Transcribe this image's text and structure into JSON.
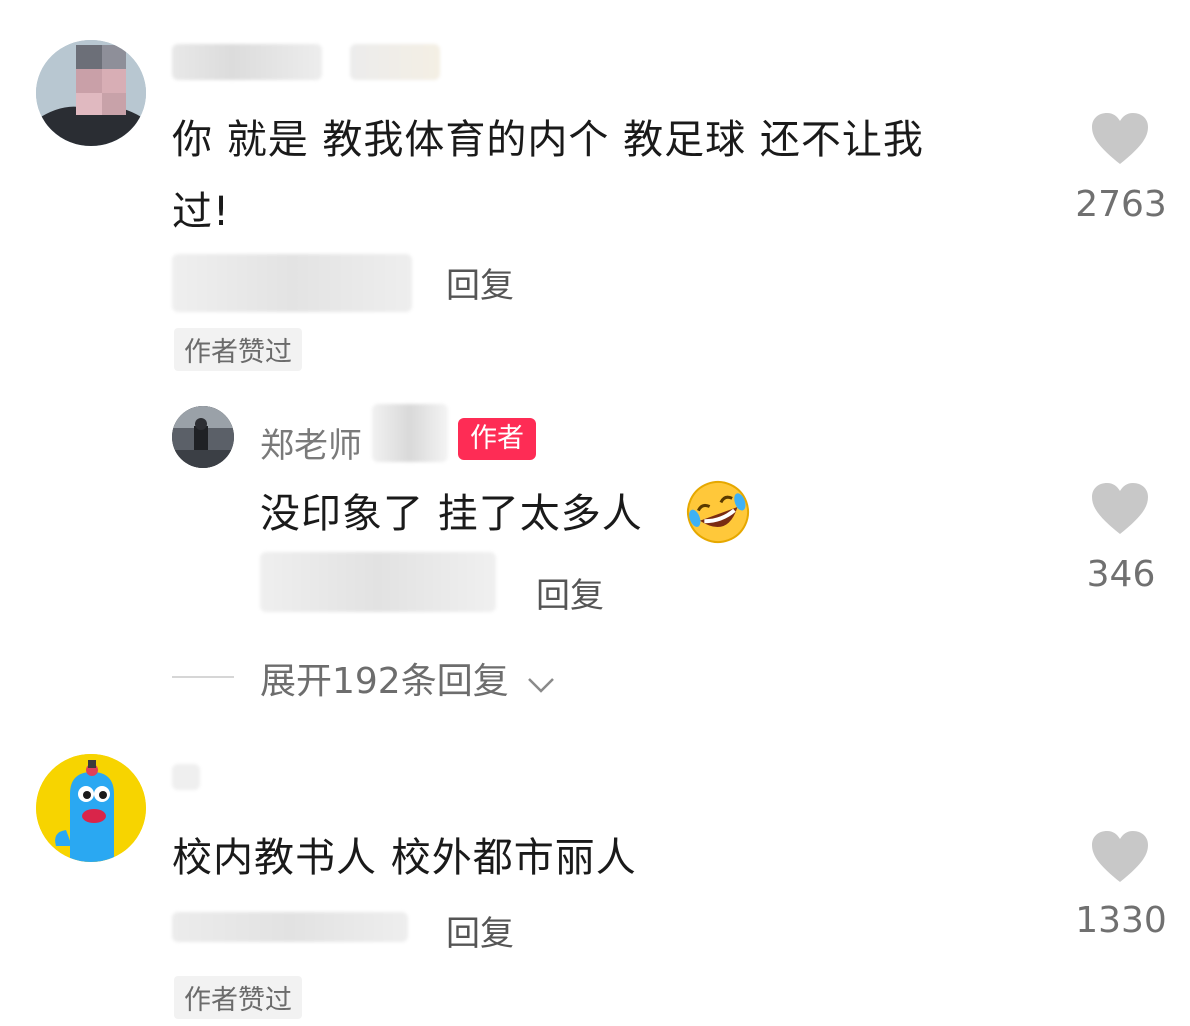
{
  "comments": [
    {
      "text_line1": "你 就是 教我体育的内个 教足球 还不让我",
      "text_line2": "过!",
      "reply_label": "回复",
      "liked_tag": "作者赞过",
      "like_count": "2763"
    },
    {
      "text": "校内教书人 校外都市丽人",
      "reply_label": "回复",
      "liked_tag": "作者赞过",
      "like_count": "1330"
    }
  ],
  "author_reply": {
    "name": "郑老师",
    "badge": "作者",
    "text": "没印象了 挂了太多人",
    "emoji": "rofl-emoji",
    "reply_label": "回复",
    "like_count": "346"
  },
  "expand_label": "展开192条回复",
  "colors": {
    "badge": "#fe2c55",
    "heart": "#c8c8c8",
    "avatar_yellow": "#f7d400",
    "avatar_blue": "#2aa8f2"
  }
}
